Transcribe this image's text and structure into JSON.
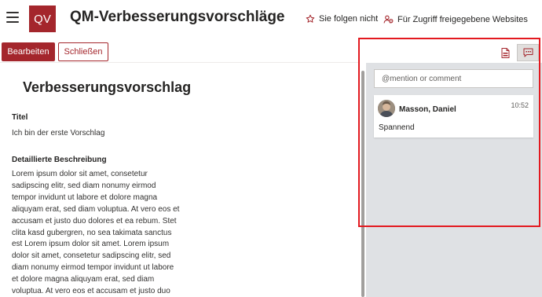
{
  "header": {
    "logo_text": "QV",
    "site_title": "QM-Verbesserungsvorschläge",
    "follow_label": "Sie folgen nicht",
    "shared_label": "Für Zugriff freigegebene Websites"
  },
  "toolbar": {
    "edit_label": "Bearbeiten",
    "close_label": "Schließen"
  },
  "form": {
    "title": "Verbesserungsvorschlag",
    "fields": [
      {
        "label": "Titel",
        "value": "Ich bin der erste Vorschlag"
      },
      {
        "label": "Detaillierte Beschreibung",
        "value": "Lorem ipsum dolor sit amet, consetetur sadipscing elitr, sed diam nonumy eirmod tempor invidunt ut labore et dolore magna aliquyam erat, sed diam voluptua. At vero eos et accusam et justo duo dolores et ea rebum. Stet clita kasd gubergren, no sea takimata sanctus est Lorem ipsum dolor sit amet. Lorem ipsum dolor sit amet, consetetur sadipscing elitr, sed diam nonumy eirmod tempor invidunt ut labore et dolore magna aliquyam erat, sed diam voluptua. At vero eos et accusam et justo duo"
      }
    ]
  },
  "comments_panel": {
    "input_placeholder": "@mention or comment",
    "comments": [
      {
        "author": "Masson, Daniel",
        "time": "10:52",
        "text": "Spannend"
      }
    ]
  },
  "colors": {
    "brand": "#a4262c",
    "highlight": "#e3191f",
    "panel_bg": "#dfe1e4"
  },
  "icons": [
    "menu-icon",
    "star-icon",
    "shared-sites-icon",
    "document-icon",
    "comment-icon"
  ]
}
